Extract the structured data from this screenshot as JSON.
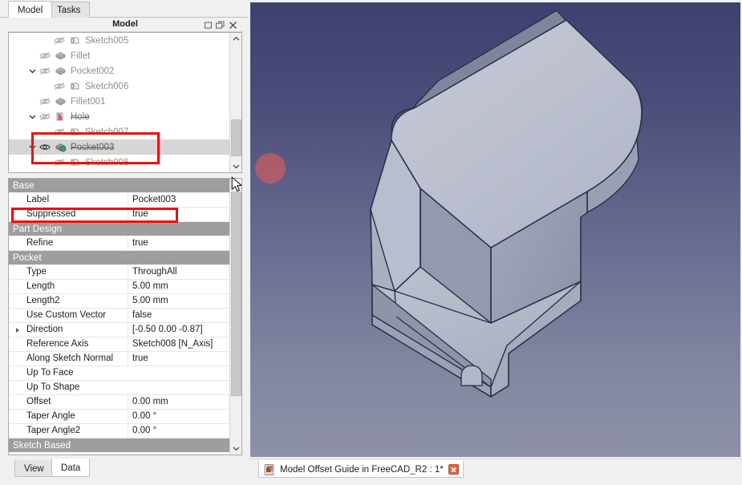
{
  "panel": {
    "tabs": [
      {
        "label": "Model",
        "active": true
      },
      {
        "label": "Tasks",
        "active": false
      }
    ],
    "title": "Model",
    "window_buttons": [
      {
        "name": "float-button",
        "glyph": "float-icon"
      },
      {
        "name": "undock-button",
        "glyph": "undock-icon"
      },
      {
        "name": "close-button",
        "glyph": "close-icon"
      }
    ]
  },
  "tree": {
    "items": [
      {
        "label": "Sketch005",
        "indent": 3,
        "icon": "sketch-icon",
        "arrow": "none",
        "eye": "hidden-eye-icon",
        "strike": false,
        "selected": false
      },
      {
        "label": "Fillet",
        "indent": 2,
        "icon": "fillet-icon",
        "arrow": "none",
        "eye": "hidden-eye-icon",
        "strike": false,
        "selected": false
      },
      {
        "label": "Pocket002",
        "indent": 2,
        "icon": "pocket-icon",
        "arrow": "expanded",
        "eye": "hidden-eye-icon",
        "strike": false,
        "selected": false
      },
      {
        "label": "Sketch006",
        "indent": 3,
        "icon": "sketch-icon",
        "arrow": "none",
        "eye": "hidden-eye-icon",
        "strike": false,
        "selected": false
      },
      {
        "label": "Fillet001",
        "indent": 2,
        "icon": "fillet-icon",
        "arrow": "none",
        "eye": "hidden-eye-icon",
        "strike": false,
        "selected": false
      },
      {
        "label": "Hole",
        "indent": 2,
        "icon": "hole-icon",
        "arrow": "expanded",
        "eye": "hidden-eye-icon",
        "strike": true,
        "selected": false
      },
      {
        "label": "Sketch007",
        "indent": 3,
        "icon": "sketch-icon",
        "arrow": "none",
        "eye": "hidden-eye-icon",
        "strike": false,
        "selected": false
      },
      {
        "label": "Pocket003",
        "indent": 2,
        "icon": "pocket-sel-icon",
        "arrow": "expanded",
        "eye": "visible-eye-icon",
        "strike": true,
        "selected": true
      },
      {
        "label": "Sketch008",
        "indent": 3,
        "icon": "sketch-icon",
        "arrow": "none",
        "eye": "hidden-eye-icon",
        "strike": false,
        "selected": false
      }
    ],
    "scrollbar": {
      "up_arrow": "chevron-up-icon",
      "down_arrow": "chevron-down-icon"
    }
  },
  "properties": {
    "rows": [
      {
        "kind": "group",
        "name": "Base"
      },
      {
        "kind": "prop",
        "name": "Label",
        "value": "Pocket003",
        "expandable": false
      },
      {
        "kind": "prop",
        "name": "Suppressed",
        "value": "true",
        "expandable": false
      },
      {
        "kind": "group",
        "name": "Part Design"
      },
      {
        "kind": "prop",
        "name": "Refine",
        "value": "true",
        "expandable": false
      },
      {
        "kind": "group",
        "name": "Pocket"
      },
      {
        "kind": "prop",
        "name": "Type",
        "value": "ThroughAll",
        "expandable": false
      },
      {
        "kind": "prop",
        "name": "Length",
        "value": "5.00 mm",
        "expandable": false
      },
      {
        "kind": "prop",
        "name": "Length2",
        "value": "5.00 mm",
        "expandable": false
      },
      {
        "kind": "prop",
        "name": "Use Custom Vector",
        "value": "false",
        "expandable": false
      },
      {
        "kind": "prop",
        "name": "Direction",
        "value": "[-0.50 0.00 -0.87]",
        "expandable": true
      },
      {
        "kind": "prop",
        "name": "Reference Axis",
        "value": "Sketch008 [N_Axis]",
        "expandable": false
      },
      {
        "kind": "prop",
        "name": "Along Sketch Normal",
        "value": "true",
        "expandable": false
      },
      {
        "kind": "prop",
        "name": "Up To Face",
        "value": "",
        "expandable": false
      },
      {
        "kind": "prop",
        "name": "Up To Shape",
        "value": "",
        "expandable": false
      },
      {
        "kind": "prop",
        "name": "Offset",
        "value": "0.00 mm",
        "expandable": false
      },
      {
        "kind": "prop",
        "name": "Taper Angle",
        "value": "0.00 °",
        "expandable": false
      },
      {
        "kind": "prop",
        "name": "Taper Angle2",
        "value": "0.00 °",
        "expandable": false
      },
      {
        "kind": "group",
        "name": "Sketch Based"
      }
    ]
  },
  "bottom_tabs": [
    {
      "label": "View",
      "active": false
    },
    {
      "label": "Data",
      "active": true
    }
  ],
  "document_tab": {
    "label": "Model Offset Guide in FreeCAD_R2 : 1*",
    "doc_icon": "freecad-document-icon",
    "close_icon": "close-icon"
  },
  "annotations": {
    "highlight_tree": "red-rect-around-pocket003",
    "highlight_property": "red-rect-around-suppressed-row",
    "click_marker": "red-circle-click-indicator",
    "cursor": "mouse-pointer"
  },
  "colors": {
    "annotation_red": "#ee1111",
    "click_dot": "rgba(224,92,92,0.62)",
    "viewport_top": "#3e4170",
    "viewport_bottom": "#8d90a8",
    "model_face_light": "#c3c7d4",
    "model_face_mid": "#aeb3c3",
    "model_face_dark": "#9298ab",
    "group_header": "#9e9e9e",
    "selection": "#d6d6d6"
  }
}
